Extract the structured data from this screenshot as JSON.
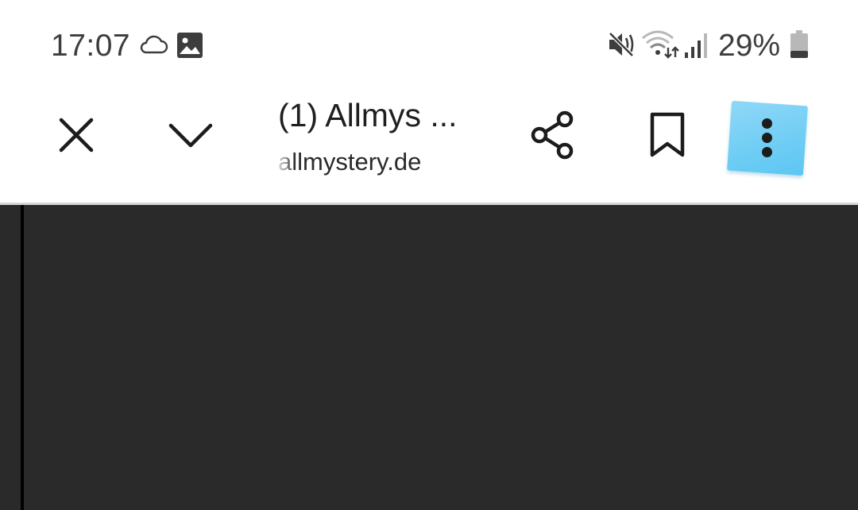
{
  "status_bar": {
    "time": "17:07",
    "battery_percent": "29%",
    "battery_level": 0.29,
    "icons": [
      "cloud-icon",
      "gallery-icon",
      "mute-icon",
      "wifi-icon",
      "signal-icon",
      "battery-icon"
    ]
  },
  "toolbar": {
    "title": "(1) Allmys ...",
    "url": "allmystery.de",
    "icons": [
      "close-icon",
      "chevron-down-icon",
      "share-icon",
      "bookmark-icon",
      "more-vert-icon"
    ],
    "menu_accent": "#6fcdf4"
  },
  "content": {
    "background": "#2a2a2a"
  }
}
